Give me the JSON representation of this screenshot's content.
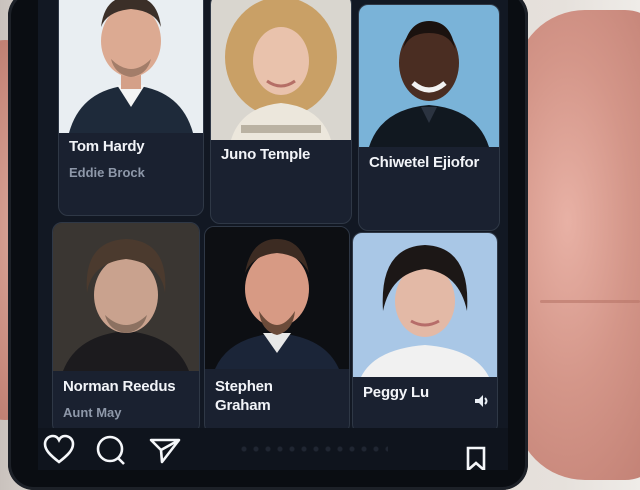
{
  "cast": [
    {
      "name": "Tom Hardy",
      "role": "Eddie Brock"
    },
    {
      "name": "Juno Temple",
      "role": ""
    },
    {
      "name": "Chiwetel Ejiofor",
      "role": ""
    },
    {
      "name": "Norman Reedus",
      "role": "Aunt May"
    },
    {
      "name": "Stephen Graham",
      "role": ""
    },
    {
      "name": "Peggy Lu",
      "role": ""
    }
  ],
  "icons": {
    "like": "heart-icon",
    "comment": "comment-icon",
    "share": "send-icon",
    "save": "bookmark-icon",
    "sound": "speaker-icon"
  },
  "colors": {
    "screen_bg": "#121823",
    "name_text": "#f2f4f8",
    "role_text": "#8e98a9"
  }
}
